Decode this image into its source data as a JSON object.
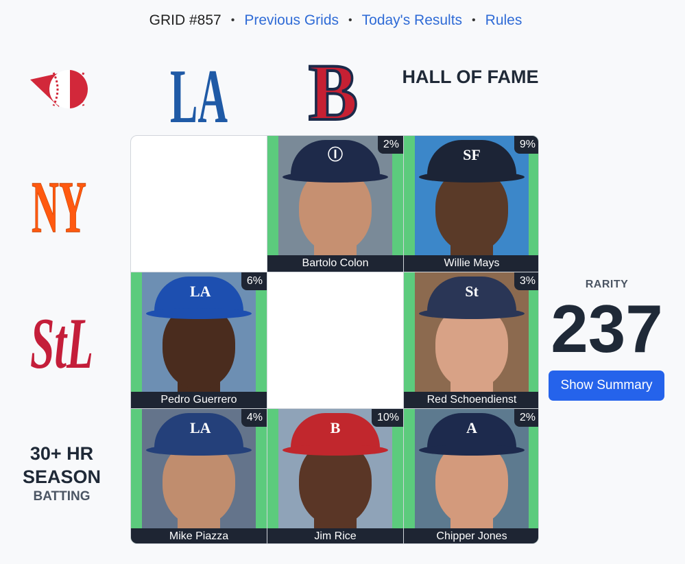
{
  "nav": {
    "grid_label": "GRID #857",
    "separator": "•",
    "links": [
      "Previous Grids",
      "Today's Results",
      "Rules"
    ]
  },
  "columns": [
    {
      "type": "team-logo",
      "icon": "dodgers-la-logo-icon"
    },
    {
      "type": "team-logo",
      "icon": "red-sox-b-logo-icon"
    },
    {
      "type": "text",
      "label": "HALL OF FAME"
    }
  ],
  "rows": [
    {
      "type": "team-logo",
      "icon": "mets-ny-logo-icon"
    },
    {
      "type": "team-logo",
      "icon": "cardinals-stl-logo-icon"
    },
    {
      "type": "text",
      "label": "30+ HR SEASON",
      "sublabel": "BATTING"
    }
  ],
  "corner": {
    "icon": "immaculate-grid-logo-icon"
  },
  "cells": [
    {
      "filled": false
    },
    {
      "filled": true,
      "player": "Bartolo Colon",
      "pct": "2%",
      "cap": "#1e2a4a",
      "bg": "#7a8a98",
      "skin": "#c69071",
      "emblem": "Ⓘ"
    },
    {
      "filled": true,
      "player": "Willie Mays",
      "pct": "9%",
      "cap": "#1c2436",
      "bg": "#3c87c9",
      "skin": "#5a3a28",
      "emblem": "SF"
    },
    {
      "filled": true,
      "player": "Pedro Guerrero",
      "pct": "6%",
      "cap": "#1d4fb0",
      "bg": "#6d8fb3",
      "skin": "#4a2c1e",
      "emblem": "LA"
    },
    {
      "filled": false
    },
    {
      "filled": true,
      "player": "Red Schoendienst",
      "pct": "3%",
      "cap": "#2a3656",
      "bg": "#8c6a4f",
      "skin": "#d8a286",
      "emblem": "St"
    },
    {
      "filled": true,
      "player": "Mike Piazza",
      "pct": "4%",
      "cap": "#24407a",
      "bg": "#64748b",
      "skin": "#c08d6e",
      "emblem": "LA"
    },
    {
      "filled": true,
      "player": "Jim Rice",
      "pct": "10%",
      "cap": "#c1272d",
      "bg": "#8fa3b8",
      "skin": "#5a3626",
      "emblem": "B"
    },
    {
      "filled": true,
      "player": "Chipper Jones",
      "pct": "2%",
      "cap": "#1d2a4d",
      "bg": "#5d7a8f",
      "skin": "#d39a7c",
      "emblem": "A"
    }
  ],
  "rarity": {
    "label": "RARITY",
    "value": "237"
  },
  "summary_button": "Show Summary",
  "colors": {
    "green": "#5ccb7d",
    "dark": "#1e2533",
    "blue": "#2563eb",
    "link": "#2f6bd6"
  }
}
